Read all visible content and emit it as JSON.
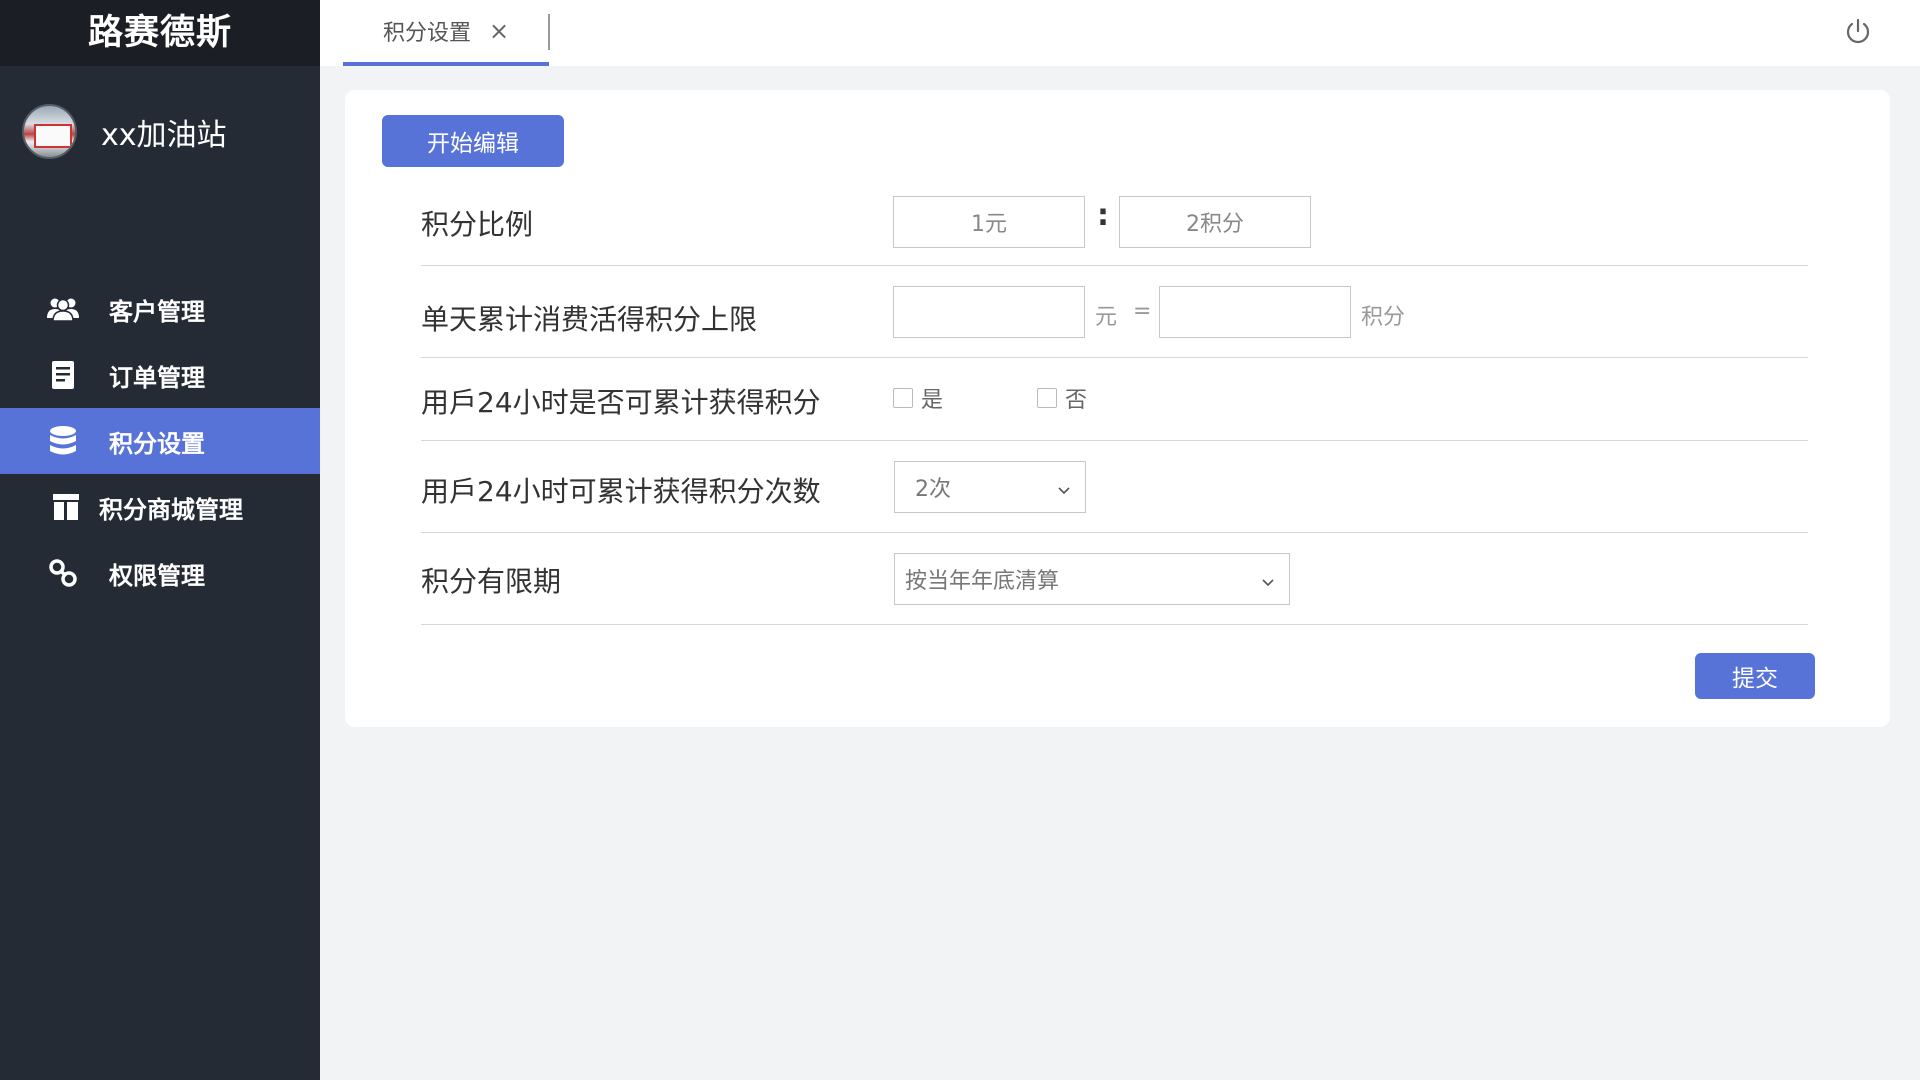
{
  "app": {
    "brand": "路赛德斯",
    "station_name": "xx加油站"
  },
  "sidebar": {
    "items": [
      {
        "label": "客户管理",
        "icon": "users-icon",
        "active": false
      },
      {
        "label": "订单管理",
        "icon": "document-icon",
        "active": false
      },
      {
        "label": "积分设置",
        "icon": "database-icon",
        "active": true
      },
      {
        "label": "积分商城管理",
        "icon": "store-icon",
        "active": false
      },
      {
        "label": "权限管理",
        "icon": "link-icon",
        "active": false
      }
    ]
  },
  "header": {
    "tab_label": "积分设置",
    "tab_close_glyph": "×",
    "power_icon": "power-icon"
  },
  "form": {
    "edit_button": "开始编辑",
    "ratio": {
      "label": "积分比例",
      "left_value": "1元",
      "separator": ":",
      "right_value": "2积分"
    },
    "daily_limit": {
      "label": "单天累计消费活得积分上限",
      "amount_value": "",
      "unit_yuan": "元",
      "equals": "=",
      "points_value": "",
      "unit_points": "积分"
    },
    "accumulate_24h": {
      "label": "用戶24小时是否可累计获得积分",
      "option_yes": "是",
      "option_no": "否",
      "yes_checked": false,
      "no_checked": false
    },
    "times_24h": {
      "label": "用戶24小时可累计获得积分次数",
      "selected": "2次"
    },
    "validity": {
      "label": "积分有限期",
      "selected": "按当年年底清算"
    },
    "submit_button": "提交"
  },
  "colors": {
    "accent": "#5873d8",
    "sidebar_bg": "#242b35",
    "brand_bg": "#1b1f25",
    "page_bg": "#f2f3f5"
  }
}
